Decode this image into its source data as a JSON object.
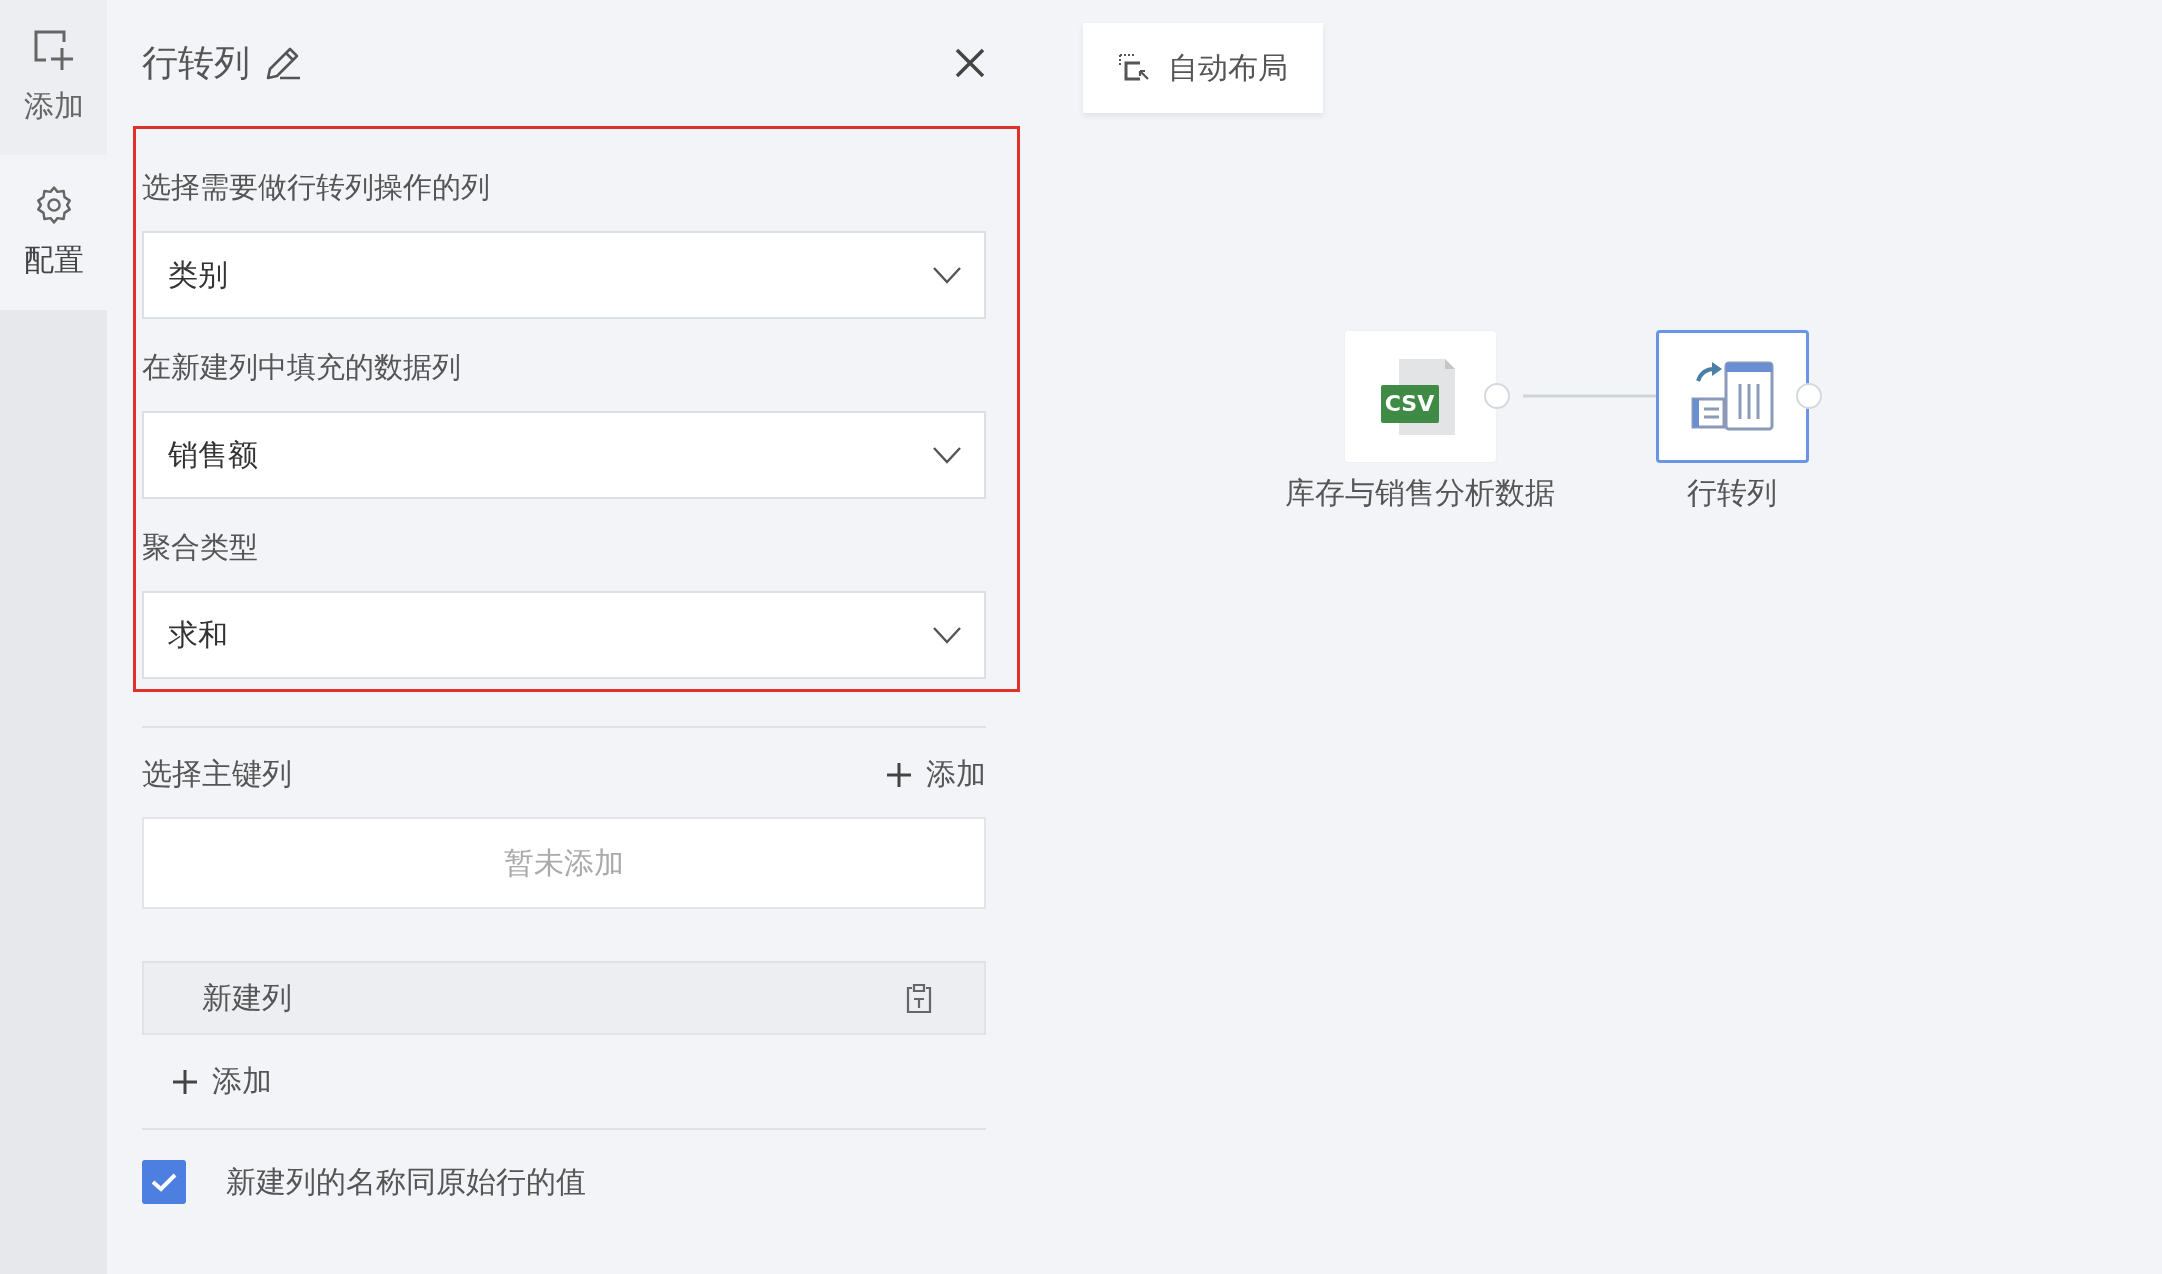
{
  "rail": {
    "items": [
      {
        "kind": "add",
        "label": "添加",
        "selected": false
      },
      {
        "kind": "config",
        "label": "配置",
        "selected": true
      }
    ]
  },
  "panel": {
    "title": "行转列",
    "fields": [
      {
        "label": "选择需要做行转列操作的列",
        "value": "类别"
      },
      {
        "label": "在新建列中填充的数据列",
        "value": "销售额"
      },
      {
        "label": "聚合类型",
        "value": "求和"
      }
    ],
    "key_columns": {
      "label": "选择主键列",
      "add": "添加",
      "empty": "暂未添加"
    },
    "new_columns": {
      "items": [
        {
          "name": "新建列"
        }
      ],
      "add": "添加"
    },
    "option": {
      "label": "新建列的名称同原始行的值",
      "checked": true
    }
  },
  "canvas": {
    "auto_layout": "自动布局",
    "nodes": [
      {
        "kind": "csv",
        "badge": "CSV",
        "label": "库存与销售分析数据",
        "selected": false
      },
      {
        "kind": "pivot",
        "label": "行转列",
        "selected": true
      }
    ]
  }
}
